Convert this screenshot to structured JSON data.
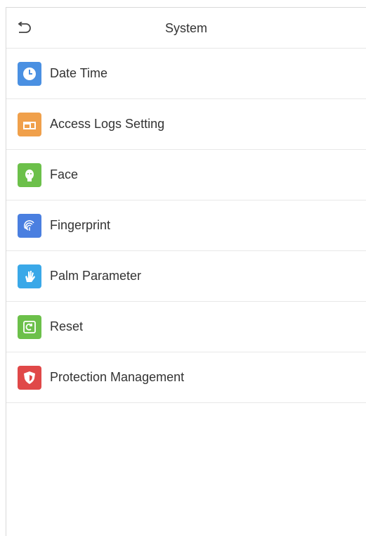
{
  "header": {
    "title": "System",
    "back_icon": "back-arrow-icon"
  },
  "menu": {
    "items": [
      {
        "label": "Date Time",
        "icon": "clock-icon",
        "color": "#4a90e2"
      },
      {
        "label": "Access Logs Setting",
        "icon": "logs-icon",
        "color": "#f0a04b"
      },
      {
        "label": "Face",
        "icon": "face-icon",
        "color": "#6cc04a"
      },
      {
        "label": "Fingerprint",
        "icon": "fingerprint-icon",
        "color": "#4a7fe0"
      },
      {
        "label": "Palm Parameter",
        "icon": "palm-icon",
        "color": "#3aa8e8"
      },
      {
        "label": "Reset",
        "icon": "reset-icon",
        "color": "#6cc04a"
      },
      {
        "label": "Protection Management",
        "icon": "shield-icon",
        "color": "#e04848"
      }
    ]
  }
}
